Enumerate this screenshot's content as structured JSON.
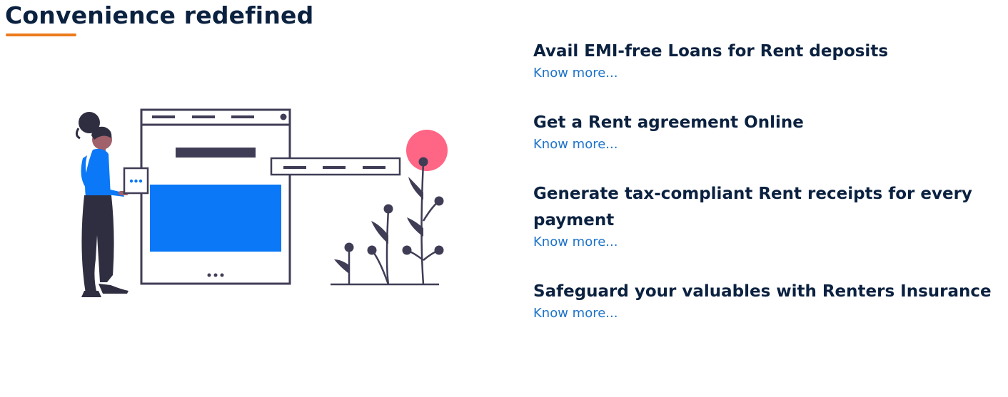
{
  "section": {
    "title": "Convenience redefined"
  },
  "features": [
    {
      "title": "Avail EMI-free Loans for Rent deposits",
      "link": "Know more..."
    },
    {
      "title": "Get a Rent agreement Online",
      "link": "Know more..."
    },
    {
      "title": "Generate tax-compliant Rent receipts for every payment",
      "link": "Know more..."
    },
    {
      "title": "Safeguard your valuables with Renters Insurance",
      "link": "Know more..."
    }
  ],
  "colors": {
    "heading": "#0b2140",
    "underline": "#ec7a1b",
    "link": "#1d73c8",
    "illustration_blue": "#0a78f7",
    "illustration_pink": "#ff6584",
    "illustration_dark": "#3f3d56"
  }
}
